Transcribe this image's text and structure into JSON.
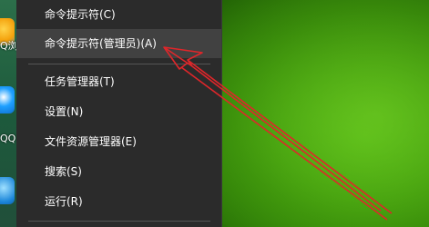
{
  "desktop": {
    "labels": [
      "Q浏",
      "QQ"
    ]
  },
  "context_menu": {
    "items": [
      {
        "label": "命令提示符(C)"
      },
      {
        "label": "命令提示符(管理员)(A)"
      },
      {
        "label": "任务管理器(T)"
      },
      {
        "label": "设置(N)"
      },
      {
        "label": "文件资源管理器(E)"
      },
      {
        "label": "搜索(S)"
      },
      {
        "label": "运行(R)"
      }
    ],
    "highlighted_index": 1
  },
  "annotation": {
    "arrow_color": "#e0262a"
  },
  "colors": {
    "menu_bg": "#2b2b2b",
    "menu_highlight": "#414141",
    "menu_text": "#ffffff",
    "desktop_green": "#3e9a0c"
  }
}
